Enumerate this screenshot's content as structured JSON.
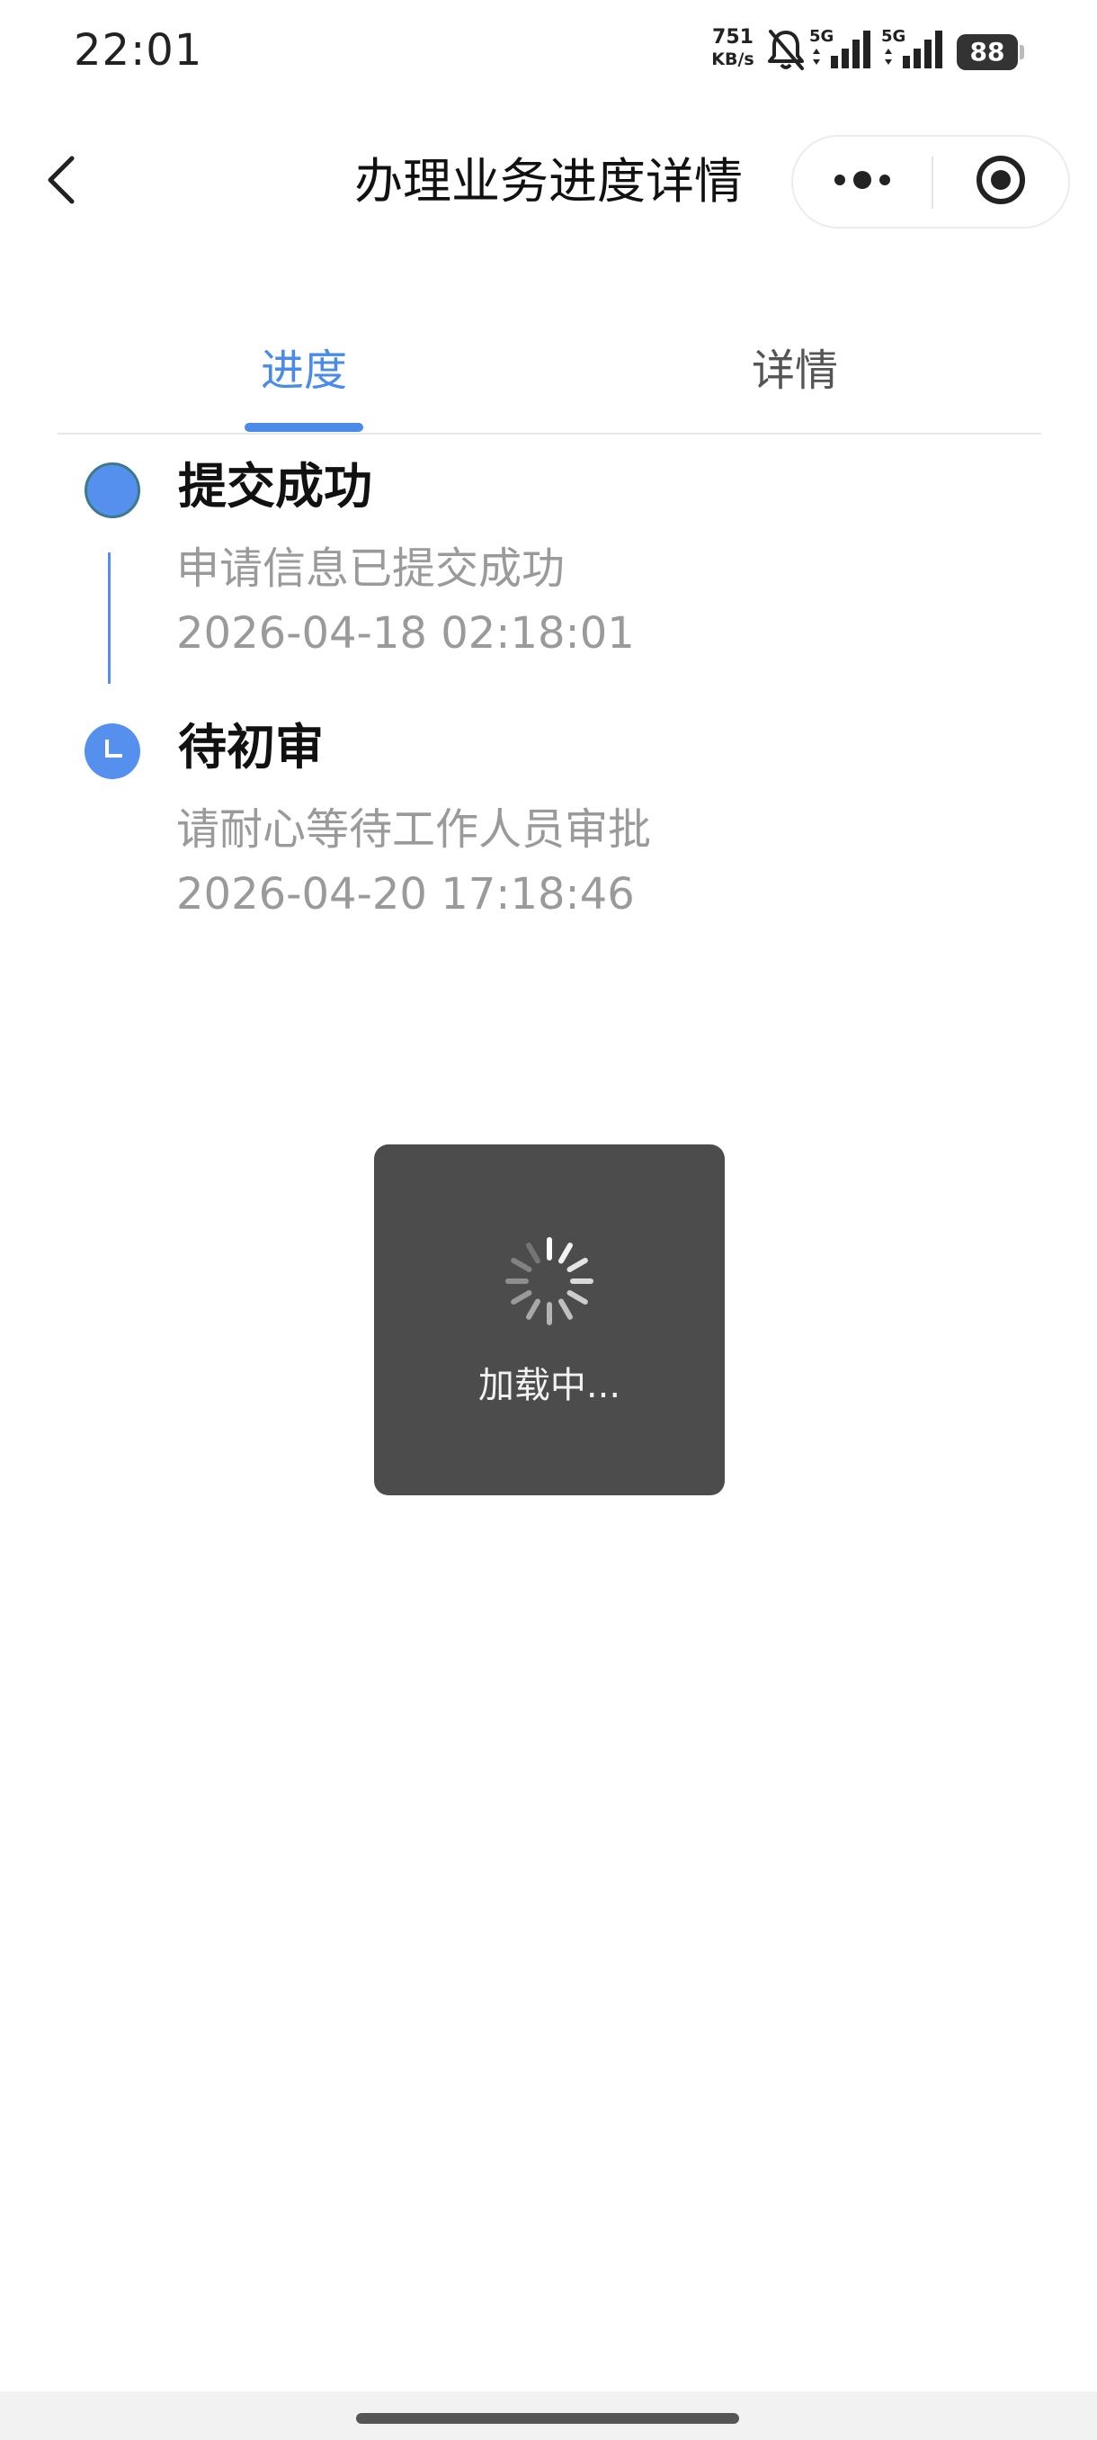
{
  "status_bar": {
    "time": "22:01",
    "net_speed": "751",
    "net_speed_unit": "KB/s",
    "signal1_label": "5G",
    "signal2_label": "5G",
    "battery": "88"
  },
  "nav": {
    "title": "办理业务进度详情"
  },
  "tabs": [
    {
      "label": "进度",
      "active": true
    },
    {
      "label": "详情",
      "active": false
    }
  ],
  "timeline": [
    {
      "title": "提交成功",
      "description": "申请信息已提交成功",
      "time": "2026-04-18 02:18:01"
    },
    {
      "title": "待初审",
      "description": "请耐心等待工作人员审批",
      "time": "2026-04-20 17:18:46"
    }
  ],
  "loading": {
    "text": "加载中..."
  },
  "colors": {
    "accent": "#4a8ae8",
    "timeline_dot": "#5590ee",
    "toast_bg": "#4c4c4c",
    "muted_text": "#9a9a9a"
  },
  "icons": {
    "back": "chevron-left-icon",
    "more": "more-dots-icon",
    "close": "target-close-icon",
    "pending": "clock-icon",
    "spinner": "spinner-icon",
    "mute": "bell-off-icon"
  }
}
